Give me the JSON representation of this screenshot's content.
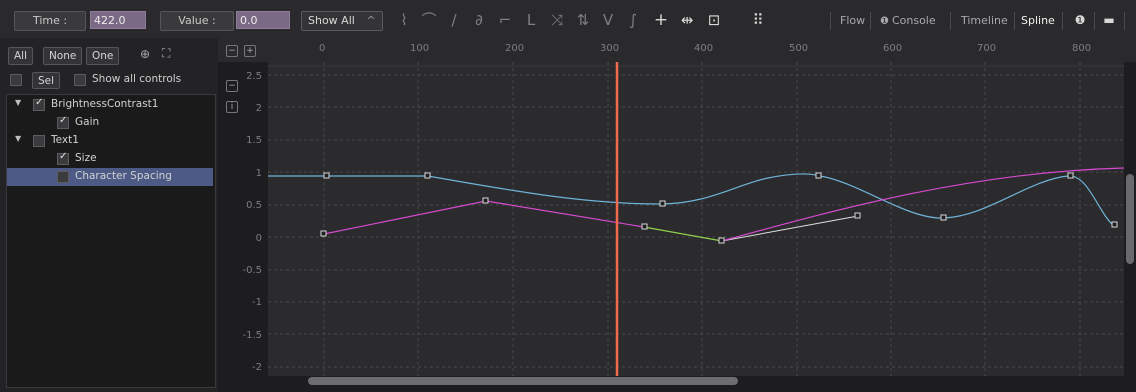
{
  "toolbar": {
    "time_label": "Time :",
    "time_value": "422.0",
    "value_label": "Value :",
    "value_value": "0.0",
    "show_all": "Show All",
    "dropdown_caret": "^",
    "tools": [
      {
        "name": "smooth-tool-icon",
        "glyph": "⌇"
      },
      {
        "name": "curve-tool-icon",
        "glyph": "⌒"
      },
      {
        "name": "linear-tool-icon",
        "glyph": "/"
      },
      {
        "name": "loop-tool-icon",
        "glyph": "∂"
      },
      {
        "name": "step-in-icon",
        "glyph": "¬"
      },
      {
        "name": "step-out-icon",
        "glyph": "L"
      },
      {
        "name": "reverse-icon",
        "glyph": "⤨"
      },
      {
        "name": "ping-pong-icon",
        "glyph": "⇅"
      },
      {
        "name": "relative-icon",
        "glyph": "V"
      },
      {
        "name": "gradient-icon",
        "glyph": "∫"
      }
    ],
    "add_icon": "+",
    "time-stretch-icon": "⇹",
    "fit-icon": "⊡",
    "more-icon": "⋮⋮",
    "tabs": [
      "Flow",
      "Console",
      "Timeline",
      "Spline"
    ],
    "active_tab": "Spline",
    "info_icon": "❶",
    "chat_icon": "▬"
  },
  "left_panel": {
    "buttons": [
      "All",
      "None",
      "One"
    ],
    "zoom_icon": "⊕",
    "expand_icon": "⛶",
    "sel_label": "Sel",
    "show_all_controls": "Show all controls",
    "tree": [
      {
        "label": "BrightnessContrast1",
        "checked": true,
        "level": 0,
        "expanded": true
      },
      {
        "label": "Gain",
        "checked": true,
        "level": 1
      },
      {
        "label": "Text1",
        "checked": false,
        "level": 0,
        "expanded": true
      },
      {
        "label": "Size",
        "checked": true,
        "level": 1
      },
      {
        "label": "Character Spacing",
        "checked": false,
        "level": 1,
        "selected": true
      }
    ]
  },
  "graph": {
    "x_ticks": [
      "0",
      "100",
      "200",
      "300",
      "400",
      "500",
      "600",
      "700",
      "800"
    ],
    "y_ticks": [
      "2.5",
      "2",
      "1.5",
      "1",
      "0.5",
      "0",
      "-0.5",
      "-1",
      "-1.5",
      "-2"
    ],
    "playhead_time": 422,
    "colors": {
      "gain": "#6fb3d8",
      "size": "#d64ad0",
      "size_segment": "#8fd04a",
      "playhead": "#f06b4c",
      "grid": "#4a4a4e"
    }
  }
}
